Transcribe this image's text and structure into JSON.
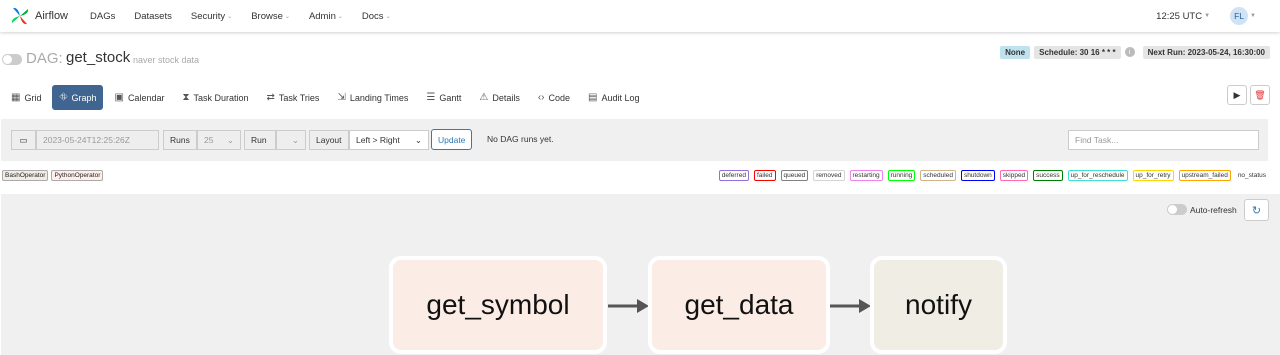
{
  "nav": {
    "brand": "Airflow",
    "items": [
      {
        "label": "DAGs",
        "dropdown": false
      },
      {
        "label": "Datasets",
        "dropdown": false
      },
      {
        "label": "Security",
        "dropdown": true
      },
      {
        "label": "Browse",
        "dropdown": true
      },
      {
        "label": "Admin",
        "dropdown": true
      },
      {
        "label": "Docs",
        "dropdown": true
      }
    ],
    "time": "12:25 UTC",
    "avatar_initials": "FL"
  },
  "dag": {
    "label": "DAG:",
    "id": "get_stock",
    "description": "naver stock data",
    "badges": {
      "state": "None",
      "schedule": "Schedule: 30 16 * * *",
      "next_run": "Next Run: 2023-05-24, 16:30:00"
    }
  },
  "tabs": [
    {
      "label": "Grid",
      "icon": "grid-icon",
      "glyph": "▦"
    },
    {
      "label": "Graph",
      "icon": "graph-icon",
      "glyph": "⛗"
    },
    {
      "label": "Calendar",
      "icon": "calendar-icon",
      "glyph": "▣"
    },
    {
      "label": "Task Duration",
      "icon": "hourglass-icon",
      "glyph": "⧗"
    },
    {
      "label": "Task Tries",
      "icon": "retry-icon",
      "glyph": "⇄"
    },
    {
      "label": "Landing Times",
      "icon": "landing-icon",
      "glyph": "⇲"
    },
    {
      "label": "Gantt",
      "icon": "gantt-icon",
      "glyph": "☰"
    },
    {
      "label": "Details",
      "icon": "warning-icon",
      "glyph": "⚠"
    },
    {
      "label": "Code",
      "icon": "code-icon",
      "glyph": "‹›"
    },
    {
      "label": "Audit Log",
      "icon": "log-icon",
      "glyph": "▤"
    }
  ],
  "controls": {
    "date_value": "2023-05-24T12:25:26Z",
    "runs_label": "Runs",
    "runs_value": "25",
    "run_label": "Run",
    "layout_label": "Layout",
    "layout_value": "Left > Right",
    "update_label": "Update",
    "no_runs_text": "No DAG runs yet.",
    "find_task_placeholder": "Find Task..."
  },
  "operators": [
    {
      "label": "BashOperator",
      "color": "#f0ede4"
    },
    {
      "label": "PythonOperator",
      "color": "#ffefeb"
    }
  ],
  "states": [
    {
      "label": "deferred",
      "color": "#9370db"
    },
    {
      "label": "failed",
      "color": "#ff0000"
    },
    {
      "label": "queued",
      "color": "#808080"
    },
    {
      "label": "removed",
      "color": "#d3d3d3"
    },
    {
      "label": "restarting",
      "color": "#ee82ee"
    },
    {
      "label": "running",
      "color": "#00ff00"
    },
    {
      "label": "scheduled",
      "color": "#d2b48c"
    },
    {
      "label": "shutdown",
      "color": "#0000ff"
    },
    {
      "label": "skipped",
      "color": "#ff69b4"
    },
    {
      "label": "success",
      "color": "#008000"
    },
    {
      "label": "up_for_reschedule",
      "color": "#40e0d0"
    },
    {
      "label": "up_for_retry",
      "color": "#ffd700"
    },
    {
      "label": "upstream_failed",
      "color": "#ffa500"
    },
    {
      "label": "no_status",
      "color": "#ffffff"
    }
  ],
  "graph": {
    "auto_refresh_label": "Auto-refresh",
    "nodes": [
      {
        "label": "get_symbol",
        "operator": "PythonOperator"
      },
      {
        "label": "get_data",
        "operator": "PythonOperator"
      },
      {
        "label": "notify",
        "operator": "BashOperator"
      }
    ]
  }
}
